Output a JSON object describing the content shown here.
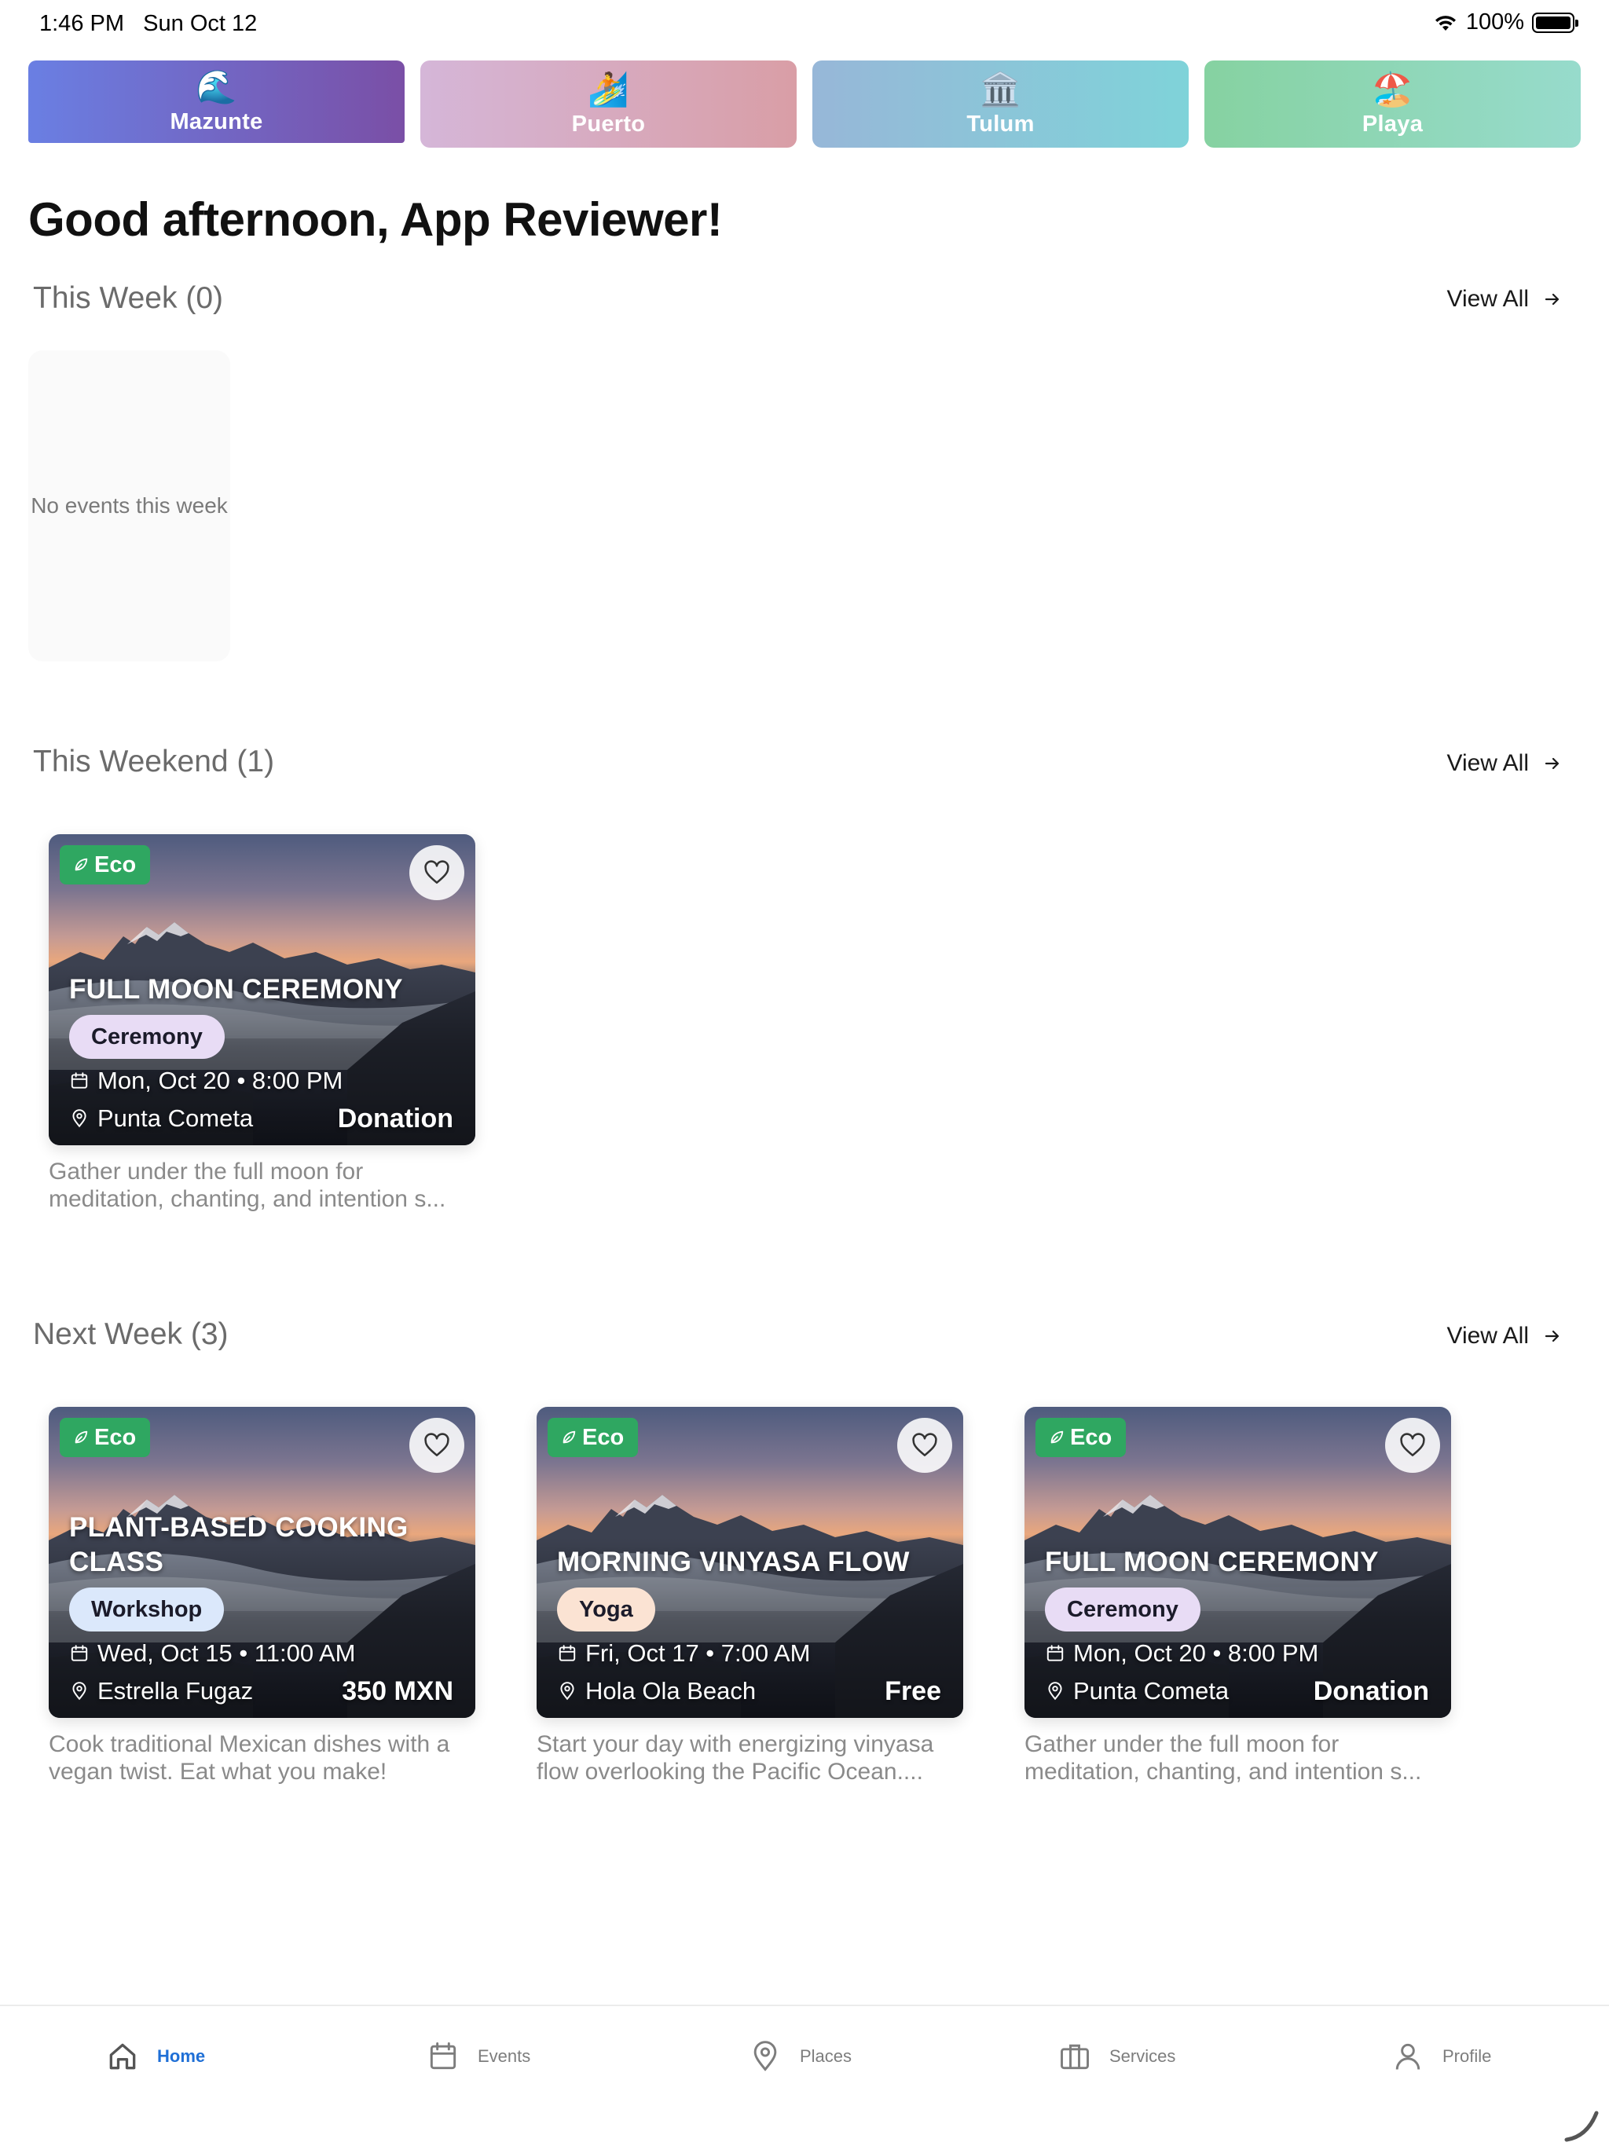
{
  "status_bar": {
    "time": "1:46 PM",
    "date": "Sun Oct 12",
    "wifi_icon": "wifi-icon",
    "battery": "100%",
    "battery_level": 1.0
  },
  "cities": [
    {
      "emoji": "🌊",
      "label": "Mazunte",
      "active": true,
      "colors": [
        "#6a7fe3",
        "#7a4fa6"
      ]
    },
    {
      "emoji": "🏄",
      "label": "Puerto",
      "active": false,
      "colors": [
        "#d5b6d8",
        "#d99ea6"
      ]
    },
    {
      "emoji": "🏛️",
      "label": "Tulum",
      "active": false,
      "colors": [
        "#97b7d8",
        "#7fd3d9"
      ]
    },
    {
      "emoji": "🏖️",
      "label": "Playa",
      "active": false,
      "colors": [
        "#86d2a1",
        "#97dbcc"
      ]
    }
  ],
  "greeting": "Good afternoon, App Reviewer!",
  "sections": {
    "this_week": {
      "title": "This Week (0)",
      "view_all": "View All",
      "empty_text": "No events this week"
    },
    "this_weekend": {
      "title": "This Weekend (1)",
      "view_all": "View All"
    },
    "next_week": {
      "title": "Next Week (3)",
      "view_all": "View All"
    }
  },
  "weekend_events": [
    {
      "badge": "Eco",
      "title": "FULL MOON CEREMONY",
      "category": "Ceremony",
      "category_color": "#e8dcf5",
      "datetime": "Mon, Oct 20 • 8:00 PM",
      "location": "Punta Cometa",
      "price": "Donation",
      "description": "Gather under the full moon for meditation, chanting, and intention s..."
    }
  ],
  "next_week_events": [
    {
      "badge": "Eco",
      "title": "PLANT-BASED COOKING CLASS",
      "category": "Workshop",
      "category_color": "#dbe8fb",
      "datetime": "Wed, Oct 15 • 11:00 AM",
      "location": "Estrella Fugaz",
      "price": "350 MXN",
      "description": "Cook traditional Mexican dishes with a vegan twist. Eat what you make!"
    },
    {
      "badge": "Eco",
      "title": "MORNING VINYASA FLOW",
      "category": "Yoga",
      "category_color": "#fbe3d3",
      "datetime": "Fri, Oct 17 • 7:00 AM",
      "location": "Hola Ola Beach",
      "price": "Free",
      "description": "Start your day with energizing vinyasa flow overlooking the Pacific Ocean...."
    },
    {
      "badge": "Eco",
      "title": "FULL MOON CEREMONY",
      "category": "Ceremony",
      "category_color": "#e8dcf5",
      "datetime": "Mon, Oct 20 • 8:00 PM",
      "location": "Punta Cometa",
      "price": "Donation",
      "description": "Gather under the full moon for meditation, chanting, and intention s..."
    }
  ],
  "tab_bar": [
    {
      "label": "Home",
      "icon": "home-icon",
      "active": true
    },
    {
      "label": "Events",
      "icon": "calendar-icon",
      "active": false
    },
    {
      "label": "Places",
      "icon": "map-pin-icon",
      "active": false
    },
    {
      "label": "Services",
      "icon": "briefcase-icon",
      "active": false
    },
    {
      "label": "Profile",
      "icon": "person-icon",
      "active": false
    }
  ],
  "colors": {
    "accent": "#1f6fd6",
    "eco_green": "#2fa761",
    "muted_text": "#6b6b6b"
  }
}
